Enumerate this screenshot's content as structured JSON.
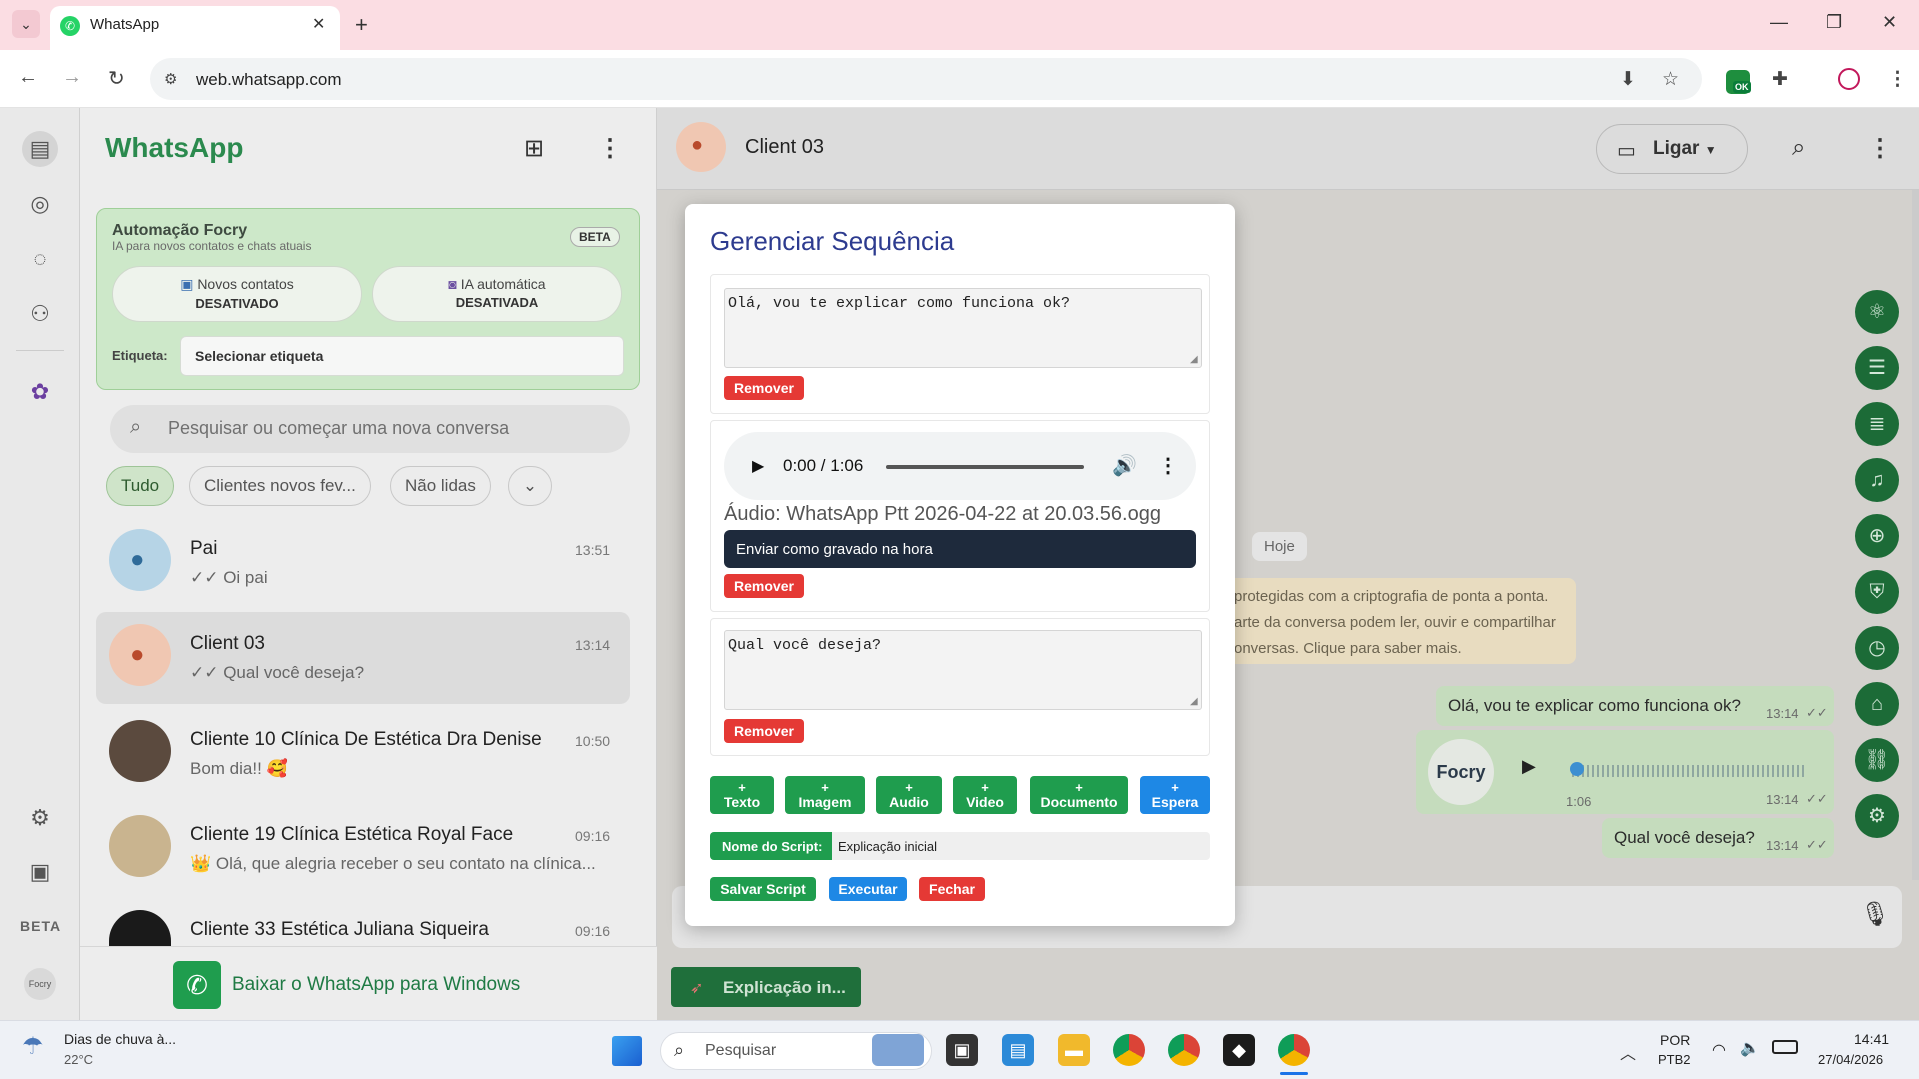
{
  "browser": {
    "tab_title": "WhatsApp",
    "url": "web.whatsapp.com",
    "ext_badge": "OK"
  },
  "whatsapp": {
    "brand": "WhatsApp",
    "rail_beta": "BETA",
    "rail_focry": "Focry",
    "focry_panel": {
      "title": "Automação Focry",
      "subtitle": "IA para novos contatos e chats atuais",
      "beta": "BETA",
      "new_contacts_label": "Novos contatos",
      "new_contacts_status": "DESATIVADO",
      "auto_ai_label": "IA automática",
      "auto_ai_status": "DESATIVADA",
      "tag_label": "Etiqueta:",
      "tag_select": "Selecionar etiqueta"
    },
    "search_placeholder": "Pesquisar ou começar uma nova conversa",
    "filters": [
      "Tudo",
      "Clientes novos fev...",
      "Não lidas"
    ],
    "chats": [
      {
        "name": "Pai",
        "preview": "✓✓ Oi pai",
        "time": "13:51"
      },
      {
        "name": "Client 03",
        "preview": "✓✓ Qual você deseja?",
        "time": "13:14"
      },
      {
        "name": "Cliente 10 Clínica De Estética Dra Denise",
        "preview": "Bom dia!! 🥰",
        "time": "10:50"
      },
      {
        "name": "Cliente 19 Clínica Estética Royal Face",
        "preview": "👑 Olá, que alegria receber o seu contato na clínica...",
        "time": "09:16"
      },
      {
        "name": "Cliente 33 Estética Juliana Siqueira",
        "preview": "",
        "time": "09:16"
      }
    ],
    "download_text": "Baixar o WhatsApp para Windows",
    "chat": {
      "contact": "Client 03",
      "call_button": "Ligar",
      "date_chip": "Hoje",
      "e2e_lines": [
        "protegidas com a criptografia de ponta a ponta.",
        "arte da conversa podem ler, ouvir e compartilhar",
        "onversas. Clique para saber mais."
      ],
      "msg1": {
        "text": "Olá, vou te explicar como funciona ok?",
        "time": "13:14"
      },
      "voice": {
        "label": "Focry",
        "duration": "1:06",
        "time": "13:14"
      },
      "msg3": {
        "text": "Qual você deseja?",
        "time": "13:14"
      },
      "script_chip": "Explicação in..."
    }
  },
  "modal": {
    "title": "Gerenciar Sequência",
    "block1_text": "Olá, vou te explicar como funciona ok?",
    "remove": "Remover",
    "audio_time": "0:00 / 1:06",
    "audio_name": "Áudio: WhatsApp Ptt 2026-04-22 at 20.03.56.ogg",
    "send_recorded": "Enviar como gravado na hora",
    "block3_text": "Qual você deseja?",
    "add_buttons": [
      "Texto",
      "Imagem",
      "Audio",
      "Video",
      "Documento",
      "Espera"
    ],
    "script_label": "Nome do Script:",
    "script_name": "Explicação inicial",
    "save": "Salvar Script",
    "run": "Executar",
    "close": "Fechar",
    "colors": {
      "green": "#1f9d4e",
      "blue": "#1e88e5",
      "red": "#e53935"
    }
  },
  "taskbar": {
    "weather_title": "Dias de chuva à...",
    "weather_temp": "22°C",
    "search_placeholder": "Pesquisar",
    "lang1": "POR",
    "lang2": "PTB2",
    "time": "14:41",
    "date": "27/04/2026"
  }
}
